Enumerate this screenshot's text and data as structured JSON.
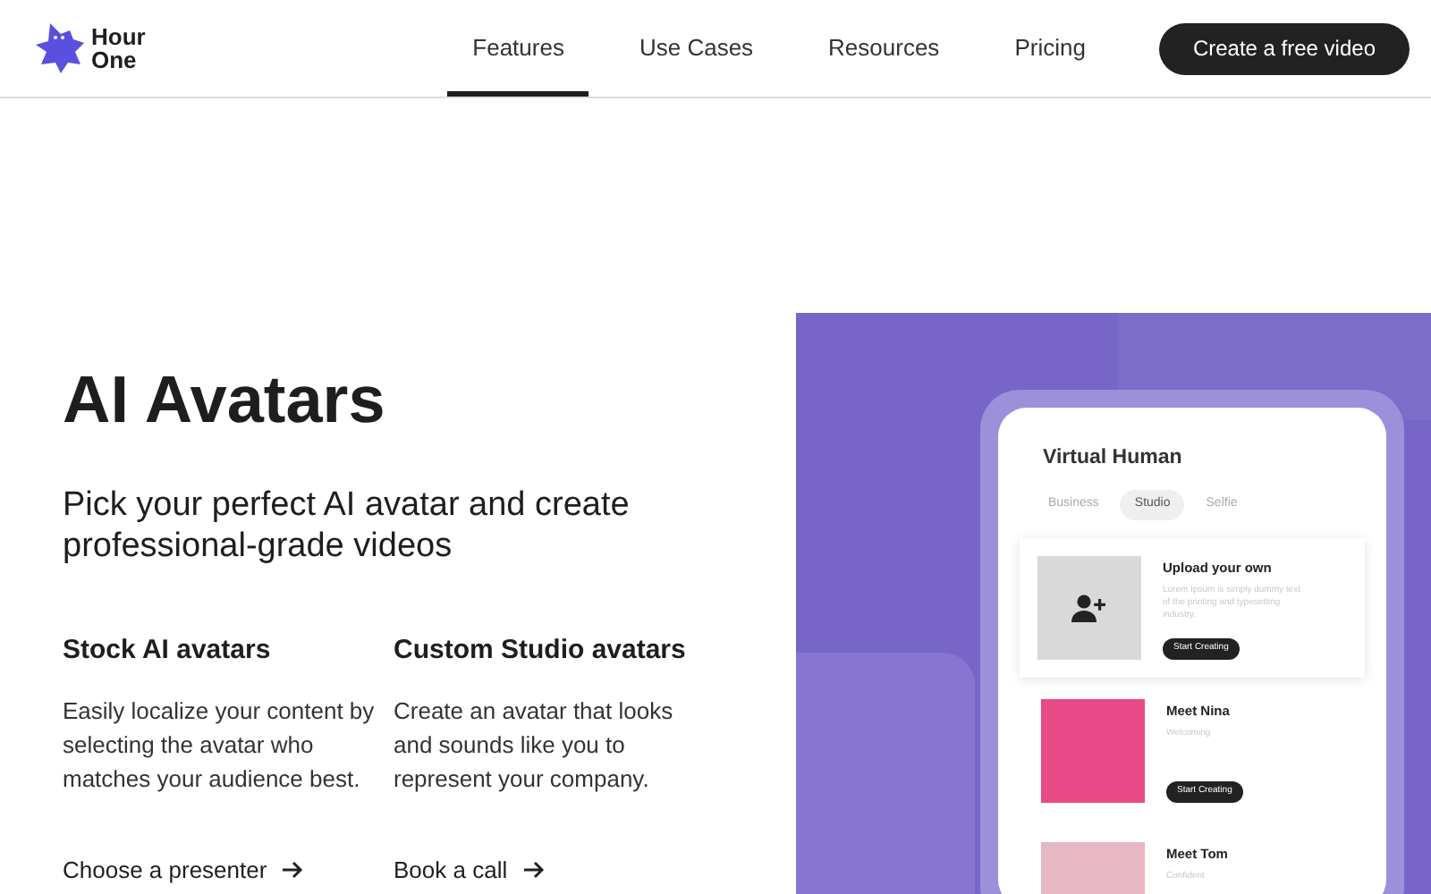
{
  "header": {
    "logo_text": [
      "Hour",
      "One"
    ],
    "nav": [
      {
        "label": "Features",
        "selected": true
      },
      {
        "label": "Use Cases",
        "selected": false
      },
      {
        "label": "Resources",
        "selected": false
      },
      {
        "label": "Pricing",
        "selected": false
      }
    ],
    "cta": "Create a free video"
  },
  "hero": {
    "title": "AI Avatars",
    "subtitle": "Pick your perfect AI avatar and create professional-grade videos",
    "columns": [
      {
        "heading": "Stock AI avatars",
        "body": "Easily localize your content by selecting the avatar who matches your audience best.",
        "link": "Choose a presenter"
      },
      {
        "heading": "Custom Studio avatars",
        "body": "Create an avatar that looks and sounds like you to represent your company.",
        "link": "Book a call"
      }
    ]
  },
  "mockup": {
    "title": "Virtual Human",
    "tabs": [
      {
        "label": "Business",
        "selected": false
      },
      {
        "label": "Studio",
        "selected": true
      },
      {
        "label": "Selfie",
        "selected": false
      }
    ],
    "cards": [
      {
        "kind": "upload",
        "name": "Upload your own",
        "description": "Lorem Ipsum is simply dummy text of the printing and typesetting industry.",
        "button": "Start Creating"
      },
      {
        "kind": "avatar",
        "name": "Meet Nina",
        "description": "Welcoming",
        "button": "Start Creating",
        "color": "#e94a86"
      },
      {
        "kind": "avatar",
        "name": "Meet Tom",
        "description": "Confident",
        "color": "#e7b8c4"
      }
    ]
  }
}
